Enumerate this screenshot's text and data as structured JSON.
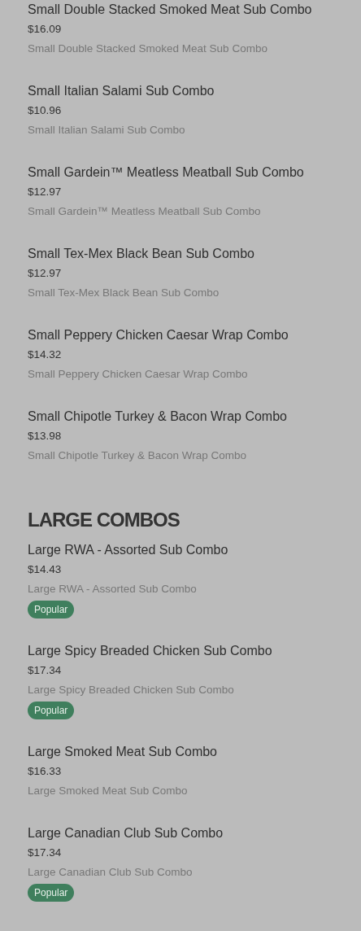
{
  "sections": [
    {
      "items": [
        {
          "name": "Small Double Stacked Smoked Meat Sub Combo",
          "price": "$16.09",
          "description": "Small Double Stacked Smoked Meat Sub Combo"
        },
        {
          "name": "Small Italian Salami Sub Combo",
          "price": "$10.96",
          "description": "Small Italian Salami Sub Combo"
        },
        {
          "name": "Small Gardein™ Meatless Meatball Sub Combo",
          "price": "$12.97",
          "description": "Small Gardein™ Meatless Meatball Sub Combo"
        },
        {
          "name": "Small Tex-Mex Black Bean Sub Combo",
          "price": "$12.97",
          "description": "Small Tex-Mex Black Bean Sub Combo"
        },
        {
          "name": "Small Peppery Chicken Caesar Wrap Combo",
          "price": "$14.32",
          "description": "Small Peppery Chicken Caesar Wrap Combo"
        },
        {
          "name": "Small Chipotle Turkey & Bacon Wrap Combo",
          "price": "$13.98",
          "description": "Small Chipotle Turkey & Bacon Wrap Combo"
        }
      ]
    },
    {
      "heading": "LARGE COMBOS",
      "items": [
        {
          "name": "Large RWA - Assorted Sub Combo",
          "price": "$14.43",
          "description": "Large RWA - Assorted Sub Combo",
          "badge": "Popular"
        },
        {
          "name": "Large Spicy Breaded Chicken Sub Combo",
          "price": "$17.34",
          "description": "Large Spicy Breaded Chicken Sub Combo",
          "badge": "Popular"
        },
        {
          "name": "Large Smoked Meat Sub Combo",
          "price": "$16.33",
          "description": "Large Smoked Meat Sub Combo"
        },
        {
          "name": "Large Canadian Club Sub Combo",
          "price": "$17.34",
          "description": "Large Canadian Club Sub Combo",
          "badge": "Popular"
        }
      ]
    }
  ]
}
